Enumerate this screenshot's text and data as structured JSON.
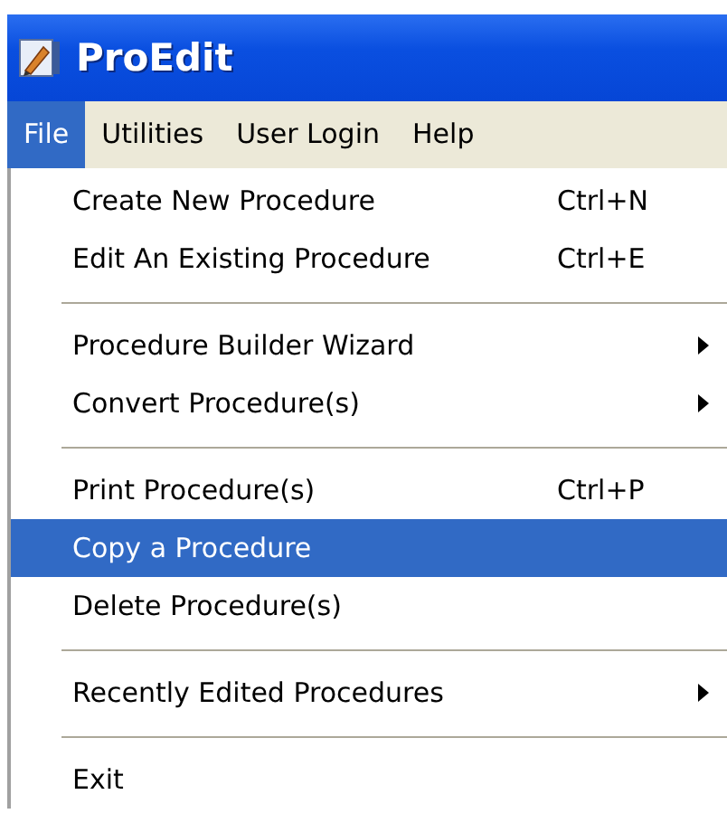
{
  "window": {
    "title": "ProEdit"
  },
  "menu_bar": [
    {
      "label": "File",
      "selected": true
    },
    {
      "label": "Utilities",
      "selected": false
    },
    {
      "label": "User Login",
      "selected": false
    },
    {
      "label": "Help",
      "selected": false
    }
  ],
  "menu": [
    [
      {
        "label": "Create New Procedure",
        "shortcut": "Ctrl+N",
        "submenu": false,
        "selected": false
      },
      {
        "label": "Edit An Existing Procedure",
        "shortcut": "Ctrl+E",
        "submenu": false,
        "selected": false
      }
    ],
    [
      {
        "label": "Procedure Builder Wizard",
        "submenu": true,
        "selected": false
      },
      {
        "label": "Convert Procedure(s)",
        "submenu": true,
        "selected": false
      }
    ],
    [
      {
        "label": "Print Procedure(s)",
        "shortcut": "Ctrl+P",
        "submenu": false,
        "selected": false
      },
      {
        "label": "Copy a Procedure",
        "submenu": false,
        "selected": true
      },
      {
        "label": "Delete Procedure(s)",
        "submenu": false,
        "selected": false
      }
    ],
    [
      {
        "label": "Recently Edited Procedures",
        "submenu": true,
        "selected": false
      }
    ],
    [
      {
        "label": "Exit",
        "submenu": false,
        "selected": false
      }
    ]
  ]
}
